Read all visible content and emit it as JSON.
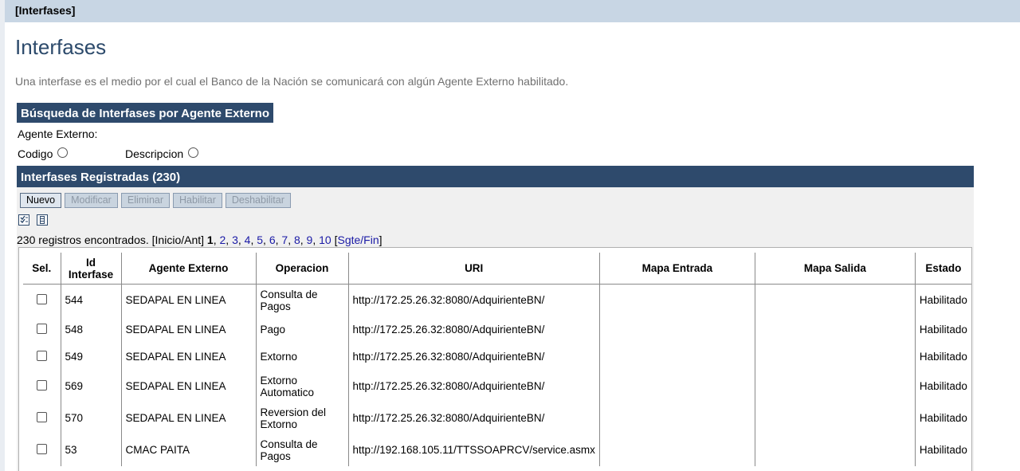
{
  "topbar": {
    "title": "[Interfases]"
  },
  "page": {
    "title": "Interfases",
    "description": "Una interfase es el medio por el cual el Banco de la Nación se comunicará con algún Agente Externo habilitado."
  },
  "search": {
    "header": "Búsqueda de Interfases por Agente Externo",
    "agent_label": "Agente Externo:",
    "radio_codigo": "Codigo",
    "radio_descripcion": "Descripcion"
  },
  "list": {
    "header": "Interfases Registradas (230)",
    "buttons": {
      "nuevo": "Nuevo",
      "modificar": "Modificar",
      "eliminar": "Eliminar",
      "habilitar": "Habilitar",
      "deshabilitar": "Deshabilitar"
    },
    "icons": [
      "select-all-icon",
      "columns-icon"
    ],
    "pager": {
      "prefix": "230 registros encontrados. [Inicio/Ant] ",
      "current": "1",
      "pages": [
        "2",
        "3",
        "4",
        "5",
        "6",
        "7",
        "8",
        "9",
        "10"
      ],
      "next": "Sgte/Fin"
    },
    "columns": [
      "Sel.",
      "Id Interfase",
      "Agente Externo",
      "Operacion",
      "URI",
      "Mapa Entrada",
      "Mapa Salida",
      "Estado"
    ],
    "rows": [
      {
        "id": "544",
        "agente": "SEDAPAL EN LINEA",
        "operacion": "Consulta de Pagos",
        "uri": "http://172.25.26.32:8080/AdquirienteBN/",
        "mapa_entrada": "",
        "mapa_salida": "",
        "estado": "Habilitado"
      },
      {
        "id": "548",
        "agente": "SEDAPAL EN LINEA",
        "operacion": "Pago",
        "uri": "http://172.25.26.32:8080/AdquirienteBN/",
        "mapa_entrada": "",
        "mapa_salida": "",
        "estado": "Habilitado"
      },
      {
        "id": "549",
        "agente": "SEDAPAL EN LINEA",
        "operacion": "Extorno",
        "uri": "http://172.25.26.32:8080/AdquirienteBN/",
        "mapa_entrada": "",
        "mapa_salida": "",
        "estado": "Habilitado"
      },
      {
        "id": "569",
        "agente": "SEDAPAL EN LINEA",
        "operacion": "Extorno Automatico",
        "uri": "http://172.25.26.32:8080/AdquirienteBN/",
        "mapa_entrada": "",
        "mapa_salida": "",
        "estado": "Habilitado"
      },
      {
        "id": "570",
        "agente": "SEDAPAL EN LINEA",
        "operacion": "Reversion del Extorno",
        "uri": "http://172.25.26.32:8080/AdquirienteBN/",
        "mapa_entrada": "",
        "mapa_salida": "",
        "estado": "Habilitado"
      },
      {
        "id": "53",
        "agente": "CMAC PAITA",
        "operacion": "Consulta de Pagos",
        "uri": "http://192.168.105.11/TTSSOAPRCV/service.asmx",
        "mapa_entrada": "",
        "mapa_salida": "",
        "estado": "Habilitado"
      }
    ]
  }
}
